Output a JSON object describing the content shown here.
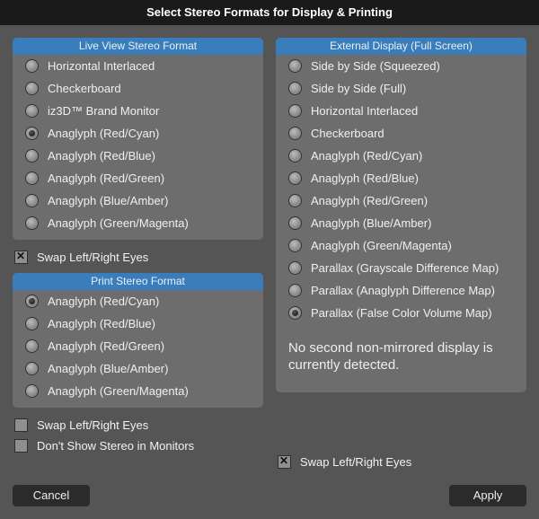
{
  "title": "Select Stereo Formats for Display & Printing",
  "liveView": {
    "header": "Live View Stereo Format",
    "options": [
      "Horizontal Interlaced",
      "Checkerboard",
      "iz3D™ Brand Monitor",
      "Anaglyph (Red/Cyan)",
      "Anaglyph (Red/Blue)",
      "Anaglyph (Red/Green)",
      "Anaglyph (Blue/Amber)",
      "Anaglyph (Green/Magenta)"
    ],
    "selectedIndex": 3,
    "swap": {
      "label": "Swap Left/Right Eyes",
      "checked": true
    }
  },
  "print": {
    "header": "Print Stereo Format",
    "options": [
      "Anaglyph (Red/Cyan)",
      "Anaglyph (Red/Blue)",
      "Anaglyph (Red/Green)",
      "Anaglyph (Blue/Amber)",
      "Anaglyph (Green/Magenta)"
    ],
    "selectedIndex": 0,
    "swap": {
      "label": "Swap Left/Right Eyes",
      "checked": false
    },
    "dontShow": {
      "label": "Don't Show Stereo in Monitors",
      "checked": false
    }
  },
  "external": {
    "header": "External Display (Full Screen)",
    "options": [
      "Side by Side (Squeezed)",
      "Side by Side (Full)",
      "Horizontal Interlaced",
      "Checkerboard",
      "Anaglyph (Red/Cyan)",
      "Anaglyph (Red/Blue)",
      "Anaglyph (Red/Green)",
      "Anaglyph (Blue/Amber)",
      "Anaglyph (Green/Magenta)",
      "Parallax (Grayscale Difference Map)",
      "Parallax (Anaglyph Difference Map)",
      "Parallax (False Color Volume Map)"
    ],
    "selectedIndex": 11,
    "info": "No second non-mirrored display is currently detected.",
    "swap": {
      "label": "Swap Left/Right Eyes",
      "checked": true
    }
  },
  "buttons": {
    "cancel": "Cancel",
    "apply": "Apply"
  }
}
